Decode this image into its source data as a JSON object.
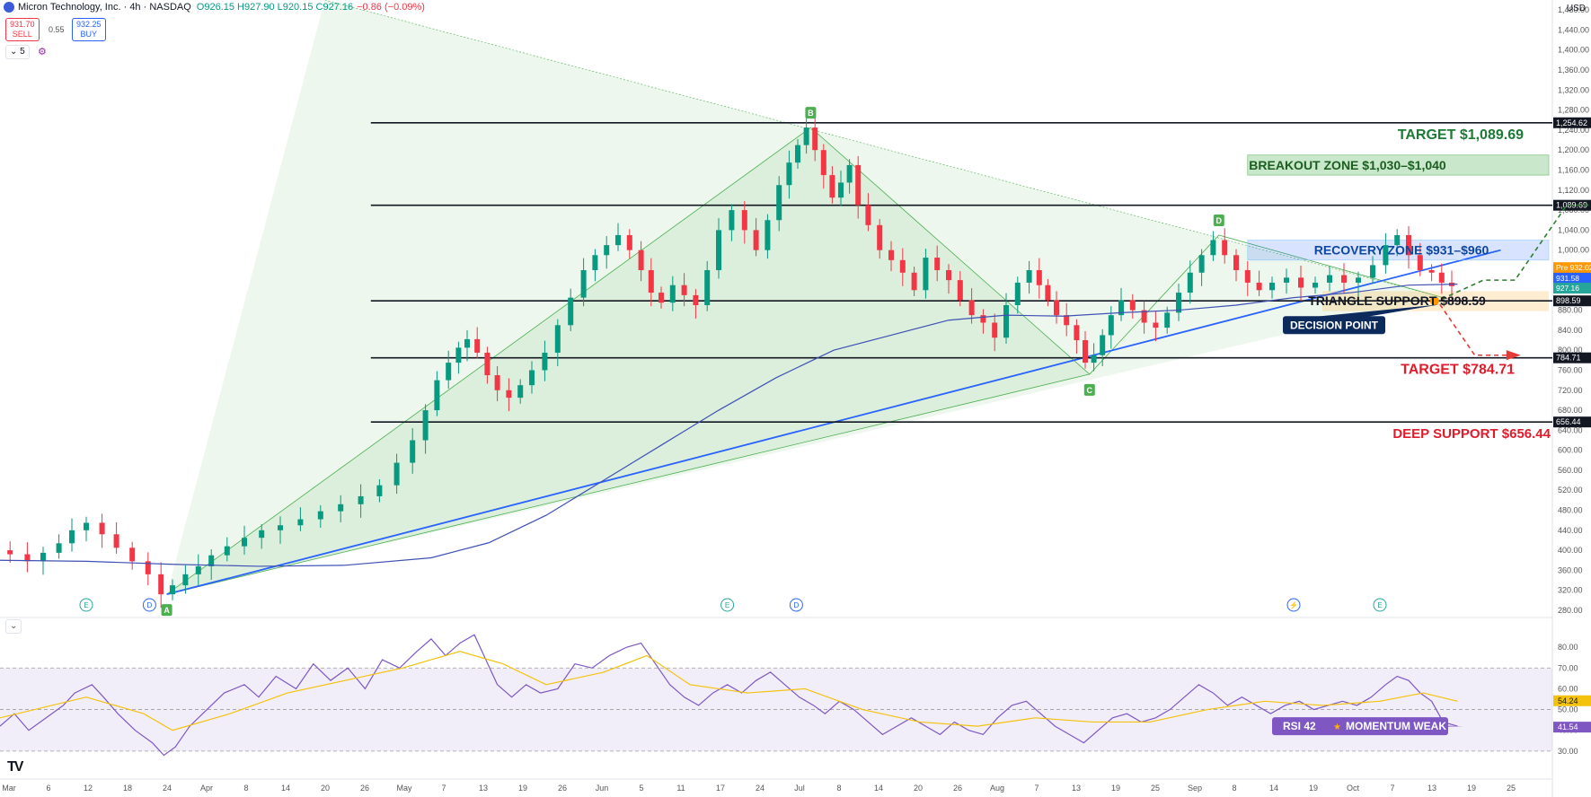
{
  "header": {
    "title": "Micron Technology, Inc. · 4h · NASDAQ",
    "ohlc": "O926.15 H927.90 L920.15 C927.16",
    "change": "−0.86 (−0.09%)",
    "sell_price": "931.70",
    "sell_label": "SELL",
    "spread": "0.55",
    "buy_price": "932.25",
    "buy_label": "BUY",
    "count": "5",
    "currency": "USD"
  },
  "colors": {
    "up": "#089981",
    "down": "#f23645",
    "trendline": "#2962ff",
    "ma": "#3f51b5",
    "rsi": "#7e57c2",
    "rsi_ma": "#f4c20d",
    "target_up": "#1b7a34",
    "target_down": "#e01b2b"
  },
  "chart_data": {
    "type": "candlestick",
    "ylim": [
      280,
      1500
    ],
    "y_ticks": [
      280,
      320,
      360,
      400,
      440,
      480,
      520,
      560,
      600,
      640,
      680,
      720,
      760,
      800,
      840,
      880,
      920,
      960,
      1000,
      1040,
      1080,
      1120,
      1160,
      1200,
      1240,
      1280,
      1320,
      1360,
      1400,
      1440,
      1480
    ],
    "x_ticks": [
      "Mar",
      "6",
      "12",
      "18",
      "24",
      "Apr",
      "8",
      "14",
      "20",
      "26",
      "May",
      "7",
      "13",
      "19",
      "26",
      "Jun",
      "5",
      "11",
      "17",
      "24",
      "Jul",
      "8",
      "14",
      "20",
      "26",
      "Aug",
      "7",
      "13",
      "19",
      "25",
      "Sep",
      "8",
      "14",
      "19",
      "Oct",
      "7",
      "13",
      "19",
      "25",
      "Oct"
    ],
    "price_path": [
      [
        0,
        400
      ],
      [
        0.7,
        392
      ],
      [
        1.2,
        378
      ],
      [
        1.8,
        395
      ],
      [
        2.3,
        414
      ],
      [
        2.7,
        440
      ],
      [
        3.3,
        455
      ],
      [
        3.8,
        432
      ],
      [
        4.3,
        405
      ],
      [
        4.9,
        378
      ],
      [
        5.4,
        352
      ],
      [
        5.8,
        312
      ],
      [
        6.2,
        330
      ],
      [
        6.7,
        352
      ],
      [
        7.1,
        368
      ],
      [
        7.6,
        390
      ],
      [
        8.2,
        408
      ],
      [
        8.8,
        425
      ],
      [
        9.4,
        440
      ],
      [
        10.1,
        450
      ],
      [
        10.8,
        462
      ],
      [
        11.5,
        478
      ],
      [
        12.2,
        492
      ],
      [
        12.9,
        508
      ],
      [
        13.5,
        530
      ],
      [
        14.1,
        575
      ],
      [
        14.6,
        620
      ],
      [
        15.0,
        680
      ],
      [
        15.4,
        740
      ],
      [
        15.8,
        775
      ],
      [
        16.1,
        805
      ],
      [
        16.4,
        822
      ],
      [
        16.8,
        795
      ],
      [
        17.1,
        750
      ],
      [
        17.5,
        720
      ],
      [
        17.9,
        705
      ],
      [
        18.3,
        730
      ],
      [
        18.7,
        760
      ],
      [
        19.2,
        795
      ],
      [
        19.6,
        850
      ],
      [
        20.1,
        905
      ],
      [
        20.5,
        960
      ],
      [
        20.9,
        990
      ],
      [
        21.3,
        1010
      ],
      [
        21.7,
        1030
      ],
      [
        22.1,
        1000
      ],
      [
        22.5,
        960
      ],
      [
        22.8,
        915
      ],
      [
        23.2,
        895
      ],
      [
        23.6,
        930
      ],
      [
        24.0,
        910
      ],
      [
        24.4,
        890
      ],
      [
        24.8,
        960
      ],
      [
        25.2,
        1040
      ],
      [
        25.7,
        1080
      ],
      [
        26.1,
        1040
      ],
      [
        26.5,
        1000
      ],
      [
        26.9,
        1060
      ],
      [
        27.3,
        1130
      ],
      [
        27.6,
        1175
      ],
      [
        27.9,
        1210
      ],
      [
        28.2,
        1245
      ],
      [
        28.5,
        1200
      ],
      [
        28.8,
        1150
      ],
      [
        29.1,
        1105
      ],
      [
        29.4,
        1135
      ],
      [
        29.7,
        1170
      ],
      [
        30.0,
        1090
      ],
      [
        30.4,
        1050
      ],
      [
        30.8,
        1000
      ],
      [
        31.2,
        980
      ],
      [
        31.6,
        955
      ],
      [
        32.0,
        920
      ],
      [
        32.4,
        985
      ],
      [
        32.8,
        960
      ],
      [
        33.2,
        940
      ],
      [
        33.6,
        900
      ],
      [
        34.0,
        870
      ],
      [
        34.4,
        855
      ],
      [
        34.8,
        825
      ],
      [
        35.2,
        890
      ],
      [
        35.6,
        935
      ],
      [
        36.0,
        960
      ],
      [
        36.3,
        930
      ],
      [
        36.6,
        900
      ],
      [
        36.9,
        870
      ],
      [
        37.3,
        850
      ],
      [
        37.6,
        820
      ],
      [
        37.9,
        775
      ],
      [
        38.2,
        790
      ],
      [
        38.5,
        830
      ],
      [
        38.8,
        870
      ],
      [
        39.2,
        900
      ],
      [
        39.6,
        880
      ],
      [
        40.0,
        855
      ],
      [
        40.4,
        845
      ],
      [
        40.8,
        875
      ],
      [
        41.2,
        915
      ],
      [
        41.6,
        955
      ],
      [
        42.0,
        990
      ],
      [
        42.4,
        1020
      ],
      [
        42.8,
        990
      ],
      [
        43.2,
        960
      ],
      [
        43.6,
        935
      ],
      [
        44.0,
        920
      ],
      [
        44.5,
        935
      ],
      [
        45.0,
        945
      ],
      [
        45.5,
        925
      ],
      [
        46.0,
        935
      ],
      [
        46.5,
        950
      ],
      [
        47.0,
        935
      ],
      [
        47.5,
        945
      ],
      [
        48.0,
        970
      ],
      [
        48.4,
        1010
      ],
      [
        48.8,
        1030
      ],
      [
        49.2,
        990
      ],
      [
        49.6,
        960
      ],
      [
        50.0,
        955
      ],
      [
        50.3,
        935
      ],
      [
        50.7,
        928
      ]
    ],
    "moving_average": [
      [
        0,
        380
      ],
      [
        3,
        378
      ],
      [
        6,
        372
      ],
      [
        9,
        368
      ],
      [
        12,
        370
      ],
      [
        15,
        385
      ],
      [
        17,
        415
      ],
      [
        19,
        470
      ],
      [
        21,
        540
      ],
      [
        23,
        610
      ],
      [
        25,
        680
      ],
      [
        27,
        745
      ],
      [
        29,
        800
      ],
      [
        31,
        830
      ],
      [
        33,
        860
      ],
      [
        35,
        870
      ],
      [
        37,
        868
      ],
      [
        39,
        875
      ],
      [
        41,
        880
      ],
      [
        43,
        890
      ],
      [
        45,
        905
      ],
      [
        47,
        915
      ],
      [
        49,
        930
      ],
      [
        50.7,
        932
      ]
    ],
    "rsi": [
      [
        0,
        42
      ],
      [
        0.5,
        48
      ],
      [
        1.0,
        40
      ],
      [
        1.6,
        46
      ],
      [
        2.2,
        52
      ],
      [
        2.6,
        58
      ],
      [
        3.2,
        62
      ],
      [
        3.6,
        56
      ],
      [
        4.1,
        48
      ],
      [
        4.7,
        40
      ],
      [
        5.3,
        34
      ],
      [
        5.7,
        28
      ],
      [
        6.1,
        32
      ],
      [
        6.6,
        42
      ],
      [
        7.2,
        50
      ],
      [
        7.8,
        58
      ],
      [
        8.5,
        62
      ],
      [
        9.0,
        56
      ],
      [
        9.6,
        66
      ],
      [
        10.3,
        60
      ],
      [
        10.9,
        72
      ],
      [
        11.5,
        64
      ],
      [
        12.1,
        70
      ],
      [
        12.7,
        60
      ],
      [
        13.3,
        74
      ],
      [
        13.9,
        70
      ],
      [
        14.5,
        78
      ],
      [
        15.0,
        84
      ],
      [
        15.5,
        76
      ],
      [
        16.0,
        82
      ],
      [
        16.5,
        86
      ],
      [
        16.9,
        74
      ],
      [
        17.3,
        62
      ],
      [
        17.8,
        56
      ],
      [
        18.3,
        62
      ],
      [
        18.8,
        58
      ],
      [
        19.4,
        60
      ],
      [
        20.0,
        72
      ],
      [
        20.6,
        70
      ],
      [
        21.2,
        76
      ],
      [
        21.8,
        80
      ],
      [
        22.3,
        82
      ],
      [
        22.8,
        72
      ],
      [
        23.3,
        62
      ],
      [
        23.8,
        56
      ],
      [
        24.3,
        52
      ],
      [
        24.8,
        58
      ],
      [
        25.3,
        62
      ],
      [
        25.8,
        58
      ],
      [
        26.3,
        64
      ],
      [
        26.8,
        68
      ],
      [
        27.3,
        62
      ],
      [
        27.8,
        56
      ],
      [
        28.3,
        52
      ],
      [
        28.7,
        48
      ],
      [
        29.2,
        54
      ],
      [
        29.7,
        50
      ],
      [
        30.2,
        44
      ],
      [
        30.7,
        38
      ],
      [
        31.2,
        42
      ],
      [
        31.7,
        46
      ],
      [
        32.2,
        42
      ],
      [
        32.7,
        38
      ],
      [
        33.2,
        44
      ],
      [
        33.7,
        40
      ],
      [
        34.2,
        38
      ],
      [
        34.7,
        46
      ],
      [
        35.2,
        52
      ],
      [
        35.7,
        54
      ],
      [
        36.2,
        48
      ],
      [
        36.7,
        42
      ],
      [
        37.2,
        38
      ],
      [
        37.7,
        34
      ],
      [
        38.2,
        40
      ],
      [
        38.7,
        46
      ],
      [
        39.2,
        48
      ],
      [
        39.7,
        44
      ],
      [
        40.2,
        46
      ],
      [
        40.7,
        50
      ],
      [
        41.2,
        56
      ],
      [
        41.7,
        62
      ],
      [
        42.2,
        58
      ],
      [
        42.7,
        52
      ],
      [
        43.2,
        56
      ],
      [
        43.7,
        52
      ],
      [
        44.2,
        48
      ],
      [
        44.7,
        52
      ],
      [
        45.2,
        54
      ],
      [
        45.7,
        50
      ],
      [
        46.2,
        52
      ],
      [
        46.7,
        54
      ],
      [
        47.2,
        52
      ],
      [
        47.7,
        56
      ],
      [
        48.2,
        62
      ],
      [
        48.6,
        66
      ],
      [
        49.0,
        64
      ],
      [
        49.4,
        58
      ],
      [
        49.8,
        54
      ],
      [
        50.2,
        44
      ],
      [
        50.7,
        42
      ]
    ],
    "rsi_ma": [
      [
        0,
        46
      ],
      [
        3,
        56
      ],
      [
        5,
        48
      ],
      [
        6,
        40
      ],
      [
        8,
        48
      ],
      [
        10,
        58
      ],
      [
        12,
        64
      ],
      [
        14,
        70
      ],
      [
        16,
        78
      ],
      [
        17.5,
        72
      ],
      [
        19,
        62
      ],
      [
        21,
        68
      ],
      [
        22.5,
        76
      ],
      [
        24,
        62
      ],
      [
        26,
        58
      ],
      [
        28,
        60
      ],
      [
        30,
        50
      ],
      [
        32,
        44
      ],
      [
        34,
        42
      ],
      [
        36,
        46
      ],
      [
        38,
        44
      ],
      [
        40,
        44
      ],
      [
        42,
        50
      ],
      [
        44,
        54
      ],
      [
        46,
        52
      ],
      [
        48,
        54
      ],
      [
        49.5,
        58
      ],
      [
        50.7,
        54
      ]
    ],
    "pattern_points": [
      {
        "label": "A",
        "t": 5.8,
        "p": 312
      },
      {
        "label": "B",
        "t": 28.2,
        "p": 1245
      },
      {
        "label": "C",
        "t": 37.9,
        "p": 752
      },
      {
        "label": "D",
        "t": 42.4,
        "p": 1030
      }
    ],
    "levels": [
      {
        "price": 1254.62,
        "tag": "1,254.62"
      },
      {
        "price": 1089.69,
        "tag": "1,089.69"
      },
      {
        "price": 898.59,
        "tag": "898.59"
      },
      {
        "price": 784.71,
        "tag": "784.71"
      },
      {
        "price": 656.44,
        "tag": "656.44"
      }
    ],
    "price_tags": [
      {
        "price": 965,
        "tag": "932.02",
        "prefix": "Pre",
        "color": "#ff9800"
      },
      {
        "price": 944,
        "tag": "931.58",
        "color": "#2962ff"
      },
      {
        "price": 924,
        "tag": "927.16",
        "color": "#26a69a"
      }
    ],
    "annotations": {
      "target_up": "TARGET  $1,089.69",
      "breakout": "BREAKOUT ZONE  $1,030–$1,040",
      "recovery": "RECOVERY ZONE   $931–$960",
      "triangle": "TRIANGLE SUPPORT  $898.59",
      "decision": "DECISION POINT",
      "target_down": "TARGET  $784.71",
      "deep_support": "DEEP SUPPORT  $656.44",
      "rsi_label": "RSI 42",
      "rsi_state": "MOMENTUM WEAK"
    },
    "rsi_ylim": [
      20,
      90
    ],
    "rsi_ticks": [
      30,
      40,
      50,
      60,
      70,
      80
    ],
    "rsi_tags": [
      {
        "value": 54.24,
        "tag": "54.24",
        "color": "#f4c20d"
      },
      {
        "value": 41.54,
        "tag": "41.54",
        "color": "#7e57c2"
      }
    ],
    "event_markers": [
      {
        "t": 5.2,
        "icon": "D"
      },
      {
        "t": 3.0,
        "icon": "E"
      },
      {
        "t": 25.3,
        "icon": "E"
      },
      {
        "t": 27.7,
        "icon": "D"
      },
      {
        "t": 45.0,
        "icon": "⚡"
      },
      {
        "t": 48.0,
        "icon": "E"
      }
    ]
  }
}
